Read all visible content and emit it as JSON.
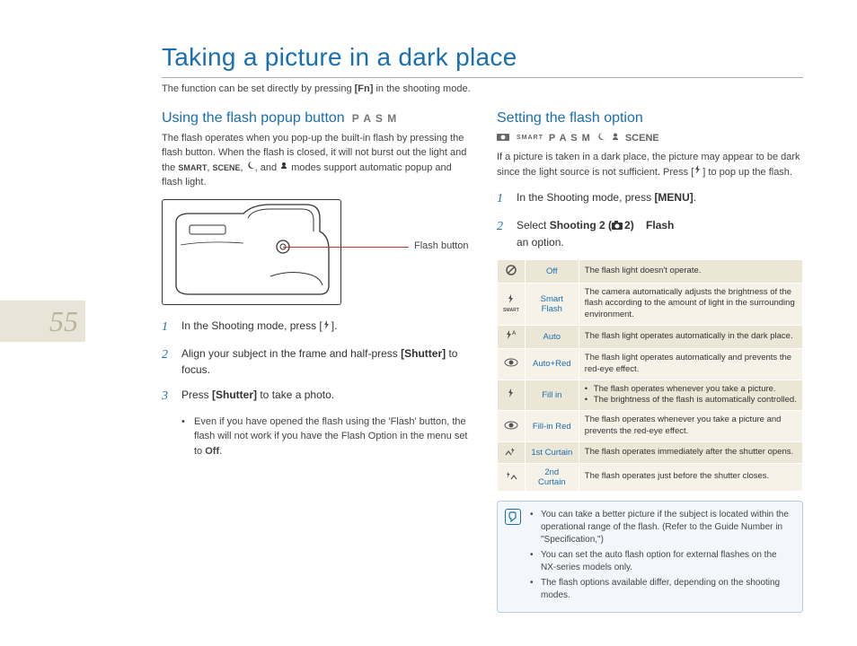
{
  "page_number": "55",
  "title": "Taking a picture in a dark place",
  "subtitle_pre": "The function can be set directly by pressing ",
  "subtitle_bold": "[Fn]",
  "subtitle_post": " in the shooting mode.",
  "left": {
    "heading": "Using the flash popup button",
    "modes": "P A S M",
    "intro_a": "The flash operates when you pop-up the built-in flash by pressing the flash button. When the flash is closed, it will not burst out the light and the ",
    "intro_b": ", ",
    "intro_c": ", ",
    "intro_d": ", and ",
    "intro_e": " modes support automatic popup and flash light.",
    "smart_label": "SMART",
    "scene_label": "SCENE",
    "flash_button_label": "Flash button",
    "steps": [
      {
        "num": "1",
        "pre": "In the Shooting mode, press [",
        "post": "]."
      },
      {
        "num": "2",
        "pre": "Align your subject in the frame and half-press ",
        "bold": "[Shutter]",
        "post": " to focus."
      },
      {
        "num": "3",
        "pre": "Press ",
        "bold": "[Shutter]",
        "post": " to take a photo."
      }
    ],
    "note": "Even if you have opened the flash using the 'Flash' button, the flash will not work if you have the Flash Option in the menu set to ",
    "note_bold": "Off",
    "note_post": "."
  },
  "right": {
    "heading": "Setting the flash option",
    "modes_smart": "SMART",
    "modes_pasm": "P A S M",
    "modes_scene": "SCENE",
    "intro": "If a picture is taken in a dark place, the picture may appear to be dark since the light source is not sufficient. Press [",
    "intro_post": "] to pop up the flash.",
    "steps": [
      {
        "num": "1",
        "pre": "In the Shooting mode, press ",
        "bold": "[MENU]",
        "post": "."
      },
      {
        "num": "2",
        "pre": "Select ",
        "bold1": "Shooting 2 (",
        "bold2": "2)",
        "arrow": " → ",
        "bold3": "Flash",
        "arrow2": " → ",
        "post": "an option."
      }
    ],
    "table": [
      {
        "name": "Off",
        "desc": "The flash light doesn't operate."
      },
      {
        "name": "Smart Flash",
        "desc": "The camera automatically adjusts the brightness of the flash according to the amount of light in the surrounding environment."
      },
      {
        "name": "Auto",
        "desc": "The flash light operates automatically in the dark place."
      },
      {
        "name": "Auto+Red",
        "desc": "The flash light operates automatically and prevents the red-eye effect."
      },
      {
        "name": "Fill in",
        "bullets": [
          "The flash operates whenever you take a picture.",
          "The brightness of the flash is automatically controlled."
        ]
      },
      {
        "name": "Fill-in Red",
        "desc": "The flash operates whenever you take a picture and prevents the red-eye effect."
      },
      {
        "name": "1st Curtain",
        "desc": "The flash operates immediately after the shutter opens."
      },
      {
        "name": "2nd Curtain",
        "desc": "The flash operates just before the shutter closes."
      }
    ],
    "tips": [
      "You can take a better picture if the subject is located within the operational range of the flash. (Refer to the Guide Number in \"Specification,\")",
      "You can set the auto flash option for external flashes on the NX-series models only.",
      "The flash options available differ, depending on the shooting modes."
    ]
  }
}
